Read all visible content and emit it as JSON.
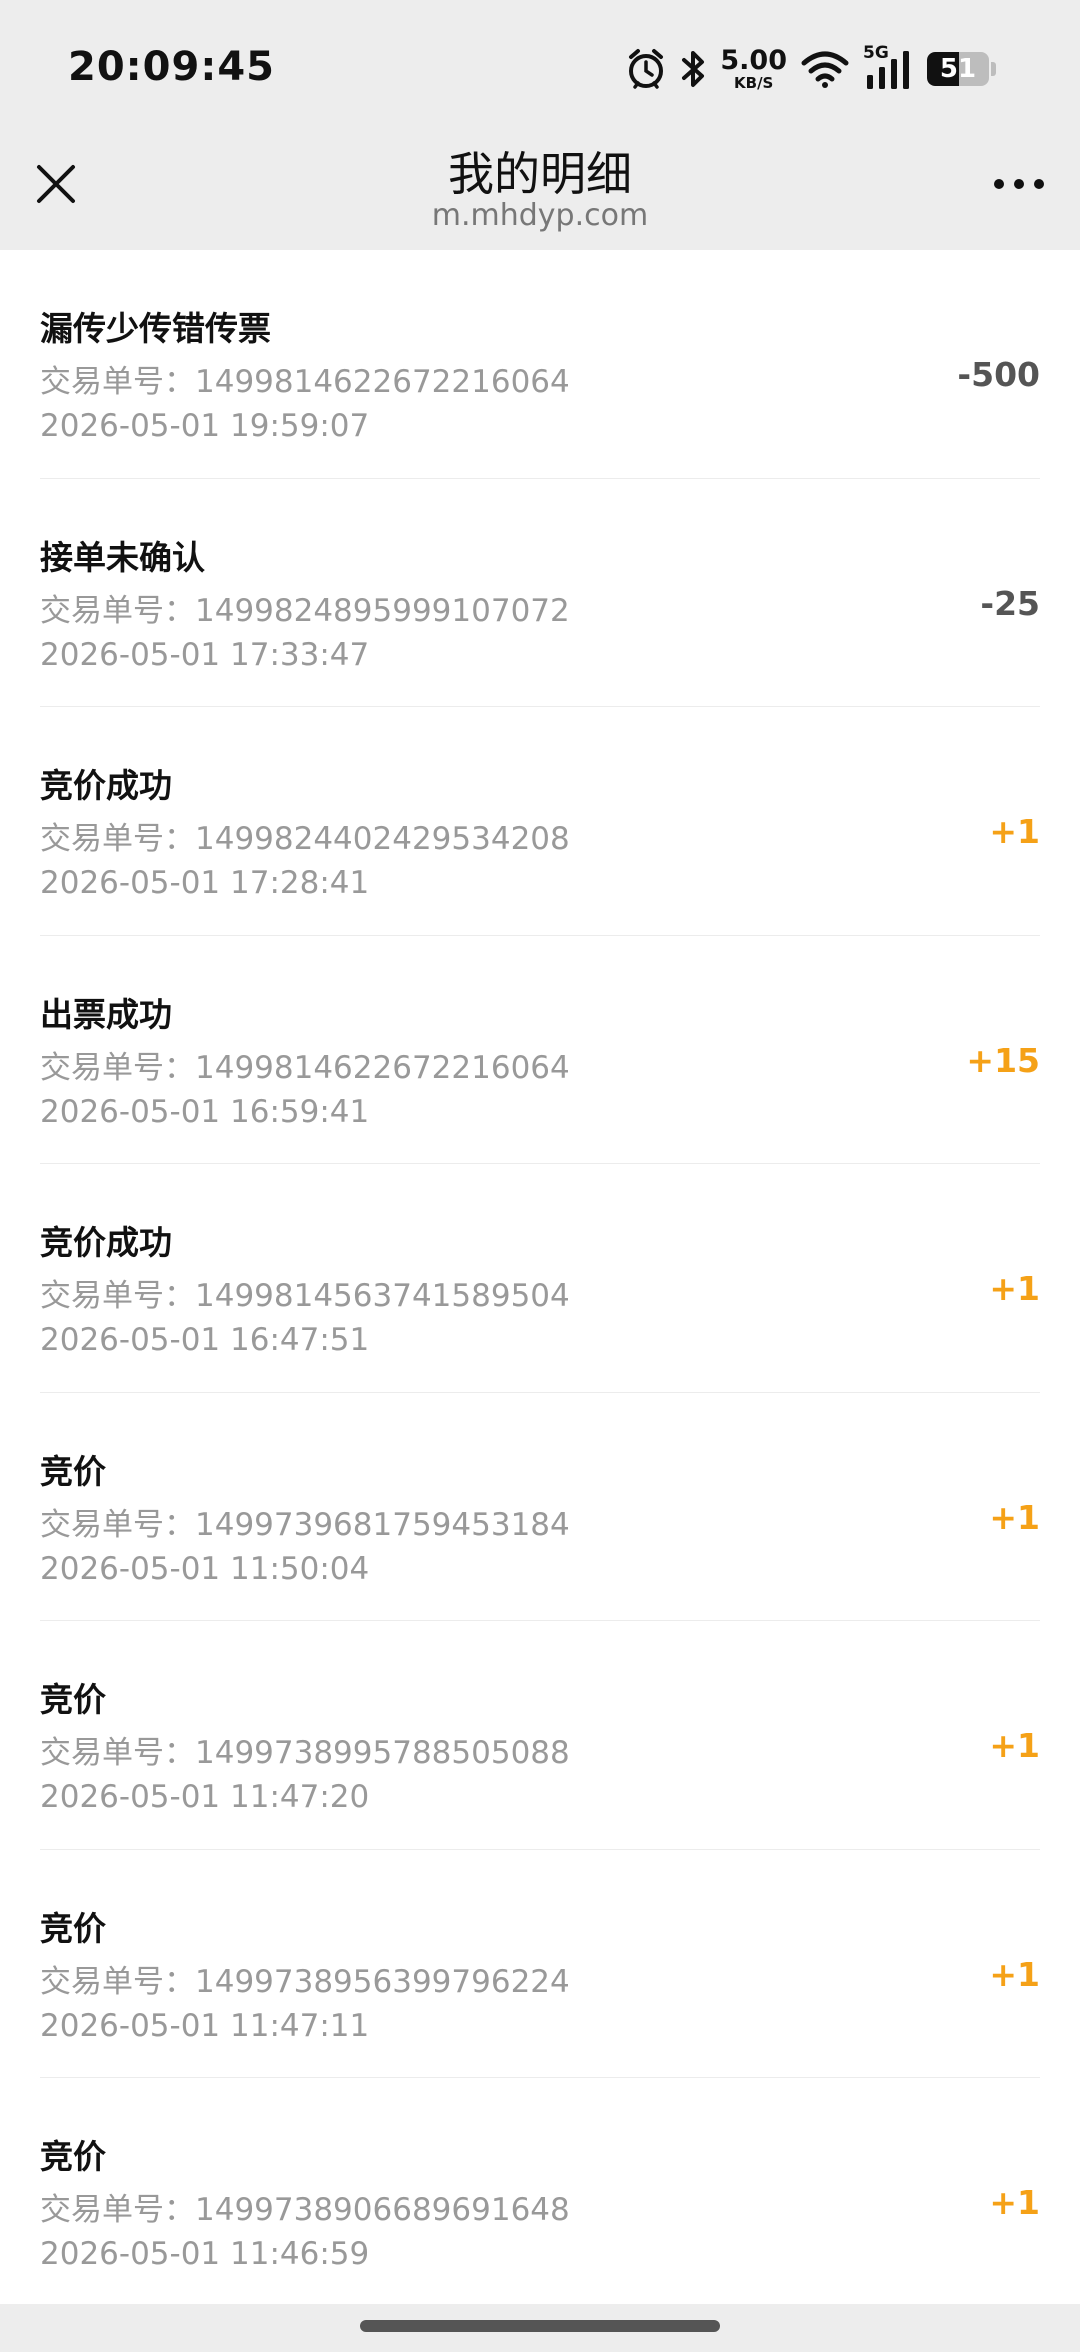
{
  "status_bar": {
    "time": "20:09:45",
    "net_speed_value": "5.00",
    "net_speed_unit": "KB/S",
    "signal_label": "5G",
    "battery_level": "51",
    "icons": [
      "alarm-icon",
      "bluetooth-icon",
      "wifi-icon",
      "cell-signal-icon",
      "battery-icon"
    ]
  },
  "header": {
    "title": "我的明细",
    "domain": "m.mhdyp.com",
    "close_icon": "close-icon",
    "more_icon": "more-icon"
  },
  "order_label": "交易单号：",
  "transactions": [
    {
      "name": "漏传少传错传票",
      "order_no": "1499814622672216064",
      "time": "2026-05-01 19:59:07",
      "amount": "-500",
      "sign": "neg"
    },
    {
      "name": "接单未确认",
      "order_no": "1499824895999107072",
      "time": "2026-05-01 17:33:47",
      "amount": "-25",
      "sign": "neg"
    },
    {
      "name": "竞价成功",
      "order_no": "1499824402429534208",
      "time": "2026-05-01 17:28:41",
      "amount": "+1",
      "sign": "pos"
    },
    {
      "name": "出票成功",
      "order_no": "1499814622672216064",
      "time": "2026-05-01 16:59:41",
      "amount": "+15",
      "sign": "pos"
    },
    {
      "name": "竞价成功",
      "order_no": "1499814563741589504",
      "time": "2026-05-01 16:47:51",
      "amount": "+1",
      "sign": "pos"
    },
    {
      "name": "竞价",
      "order_no": "1499739681759453184",
      "time": "2026-05-01 11:50:04",
      "amount": "+1",
      "sign": "pos"
    },
    {
      "name": "竞价",
      "order_no": "1499738995788505088",
      "time": "2026-05-01 11:47:20",
      "amount": "+1",
      "sign": "pos"
    },
    {
      "name": "竞价",
      "order_no": "1499738956399796224",
      "time": "2026-05-01 11:47:11",
      "amount": "+1",
      "sign": "pos"
    },
    {
      "name": "竞价",
      "order_no": "1499738906689691648",
      "time": "2026-05-01 11:46:59",
      "amount": "+1",
      "sign": "pos"
    }
  ],
  "colors": {
    "positive": "#f5a117",
    "negative": "#555555",
    "header_bg": "#ededed"
  }
}
